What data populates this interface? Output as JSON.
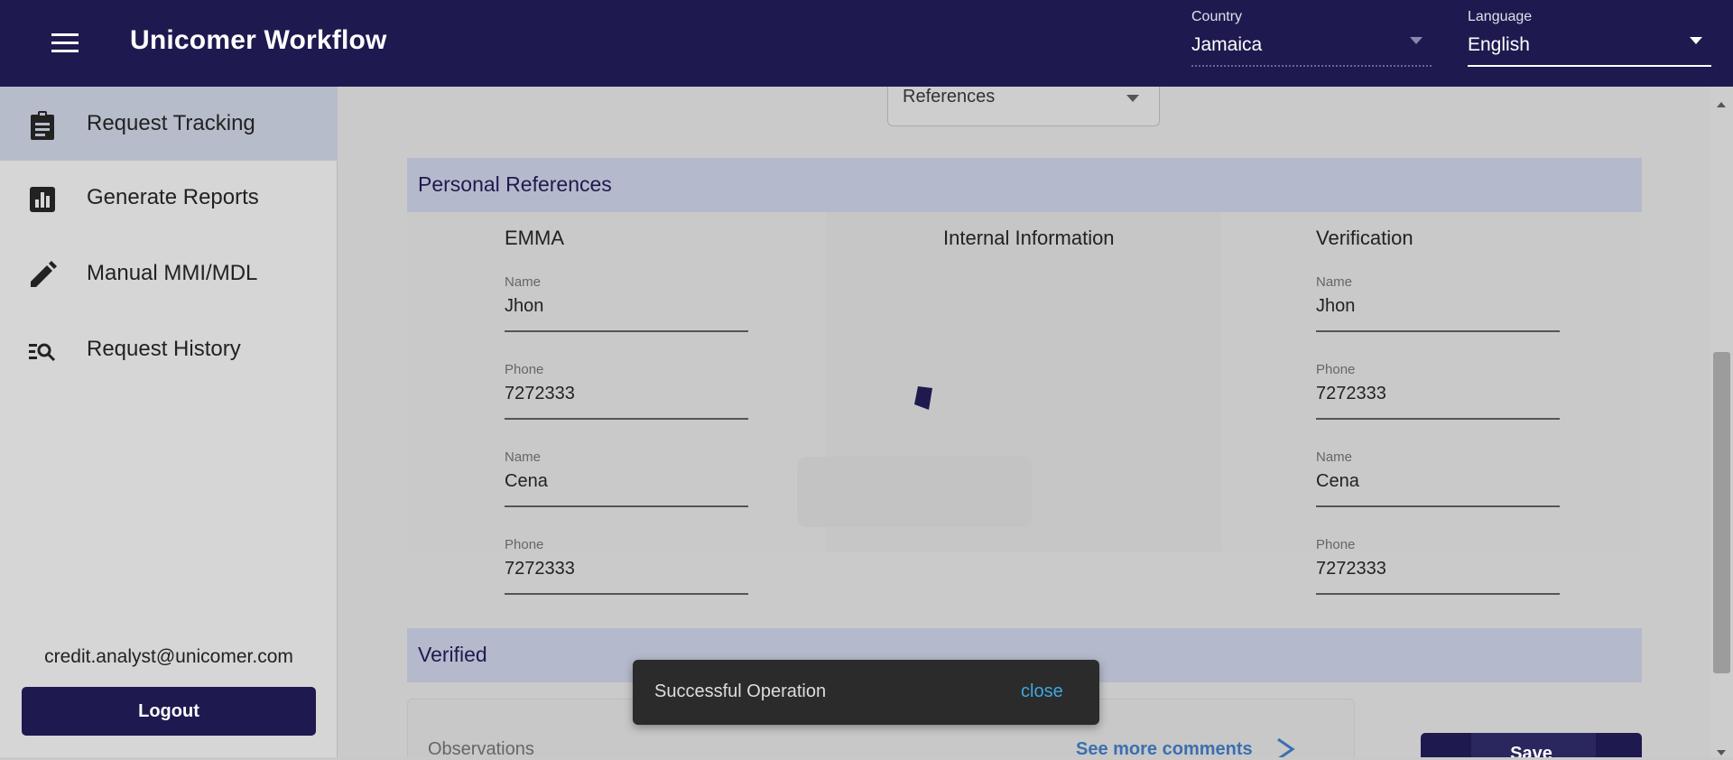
{
  "header": {
    "title": "Unicomer Workflow",
    "country": {
      "label": "Country",
      "value": "Jamaica"
    },
    "language": {
      "label": "Language",
      "value": "English"
    }
  },
  "sidebar": {
    "items": [
      {
        "label": "Request Tracking",
        "icon": "clipboard-icon",
        "active": true
      },
      {
        "label": "Generate Reports",
        "icon": "bar-chart-icon",
        "active": false
      },
      {
        "label": "Manual MMI/MDL",
        "icon": "pencil-icon",
        "active": false
      },
      {
        "label": "Request History",
        "icon": "list-search-icon",
        "active": false
      }
    ],
    "user_email": "credit.analyst@unicomer.com",
    "logout_label": "Logout"
  },
  "main": {
    "section_select": {
      "value": "References"
    },
    "personal_references": {
      "title": "Personal References",
      "columns": {
        "left": "EMMA",
        "middle": "Internal Information",
        "right": "Verification"
      },
      "left_fields": [
        {
          "label": "Name",
          "value": "Jhon"
        },
        {
          "label": "Phone",
          "value": "7272333"
        },
        {
          "label": "Name",
          "value": "Cena"
        },
        {
          "label": "Phone",
          "value": "7272333"
        }
      ],
      "right_fields": [
        {
          "label": "Name",
          "value": "Jhon"
        },
        {
          "label": "Phone",
          "value": "7272333"
        },
        {
          "label": "Name",
          "value": "Cena"
        },
        {
          "label": "Phone",
          "value": "7272333"
        }
      ]
    },
    "verified": {
      "title": "Verified"
    },
    "observations": {
      "label": "Observations",
      "see_more": "See more comments"
    },
    "save_label": "Save"
  },
  "snackbar": {
    "message": "Successful Operation",
    "action": "close"
  },
  "colors": {
    "primary": "#1e1a4f",
    "band": "#b4bacb",
    "link": "#3fa7e0"
  }
}
